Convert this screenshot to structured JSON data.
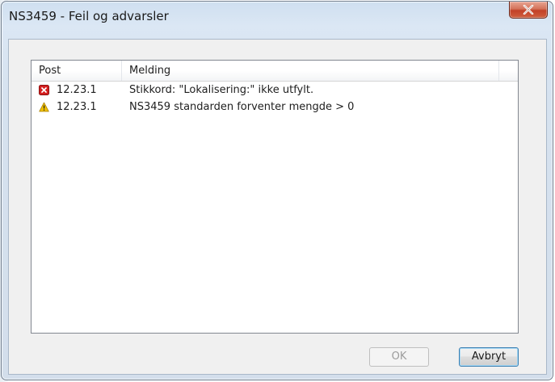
{
  "window": {
    "title": "NS3459 - Feil og advarsler"
  },
  "list": {
    "columns": [
      {
        "label": "Post"
      },
      {
        "label": "Melding"
      }
    ],
    "rows": [
      {
        "severity": "error-icon",
        "post": "12.23.1",
        "message": "Stikkord: \"Lokalisering:\" ikke utfylt."
      },
      {
        "severity": "warning-icon",
        "post": "12.23.1",
        "message": "NS3459 standarden forventer mengde > 0"
      }
    ]
  },
  "buttons": {
    "ok_label": "OK",
    "ok_enabled": false,
    "cancel_label": "Avbryt"
  },
  "colors": {
    "error": "#d42020",
    "warning": "#f2c200",
    "close_button": "#c24128"
  }
}
